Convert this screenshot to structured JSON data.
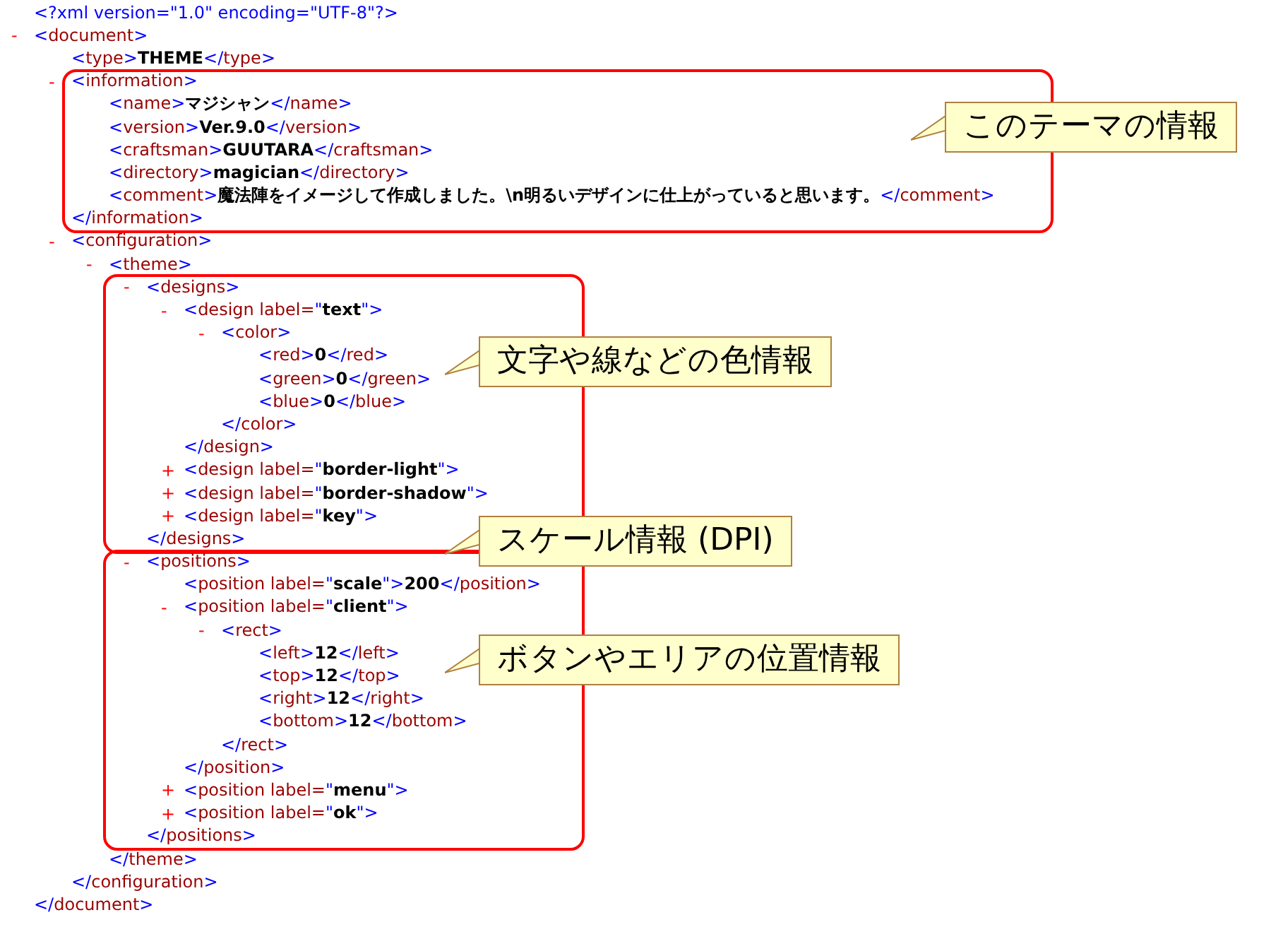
{
  "declaration": "<?xml version=\"1.0\" encoding=\"UTF-8\"?>",
  "tree": {
    "toggle": "-",
    "line": "<document>",
    "close": "</document>",
    "children": [
      {
        "line": "<type>THEME</type>"
      },
      {
        "toggle": "-",
        "line": "<information>",
        "close": "</information>",
        "highlight": true,
        "children": [
          {
            "line": "<name>マジシャン</name>"
          },
          {
            "line": "<version>Ver.9.0</version>"
          },
          {
            "line": "<craftsman>GUUTARA</craftsman>"
          },
          {
            "line": "<directory>magician</directory>"
          },
          {
            "line": "<comment>魔法陣をイメージして作成しました。\\n明るいデザインに仕上がっていると思います。</comment>"
          }
        ]
      },
      {
        "toggle": "-",
        "line": "<configuration>",
        "close": "</configuration>",
        "children": [
          {
            "toggle": "-",
            "line": "<theme>",
            "close": "</theme>",
            "children": [
              {
                "toggle": "-",
                "line": "<designs>",
                "close": "</designs>",
                "highlight": true,
                "children": [
                  {
                    "toggle": "-",
                    "line": "<design label=\"text\">",
                    "close": "</design>",
                    "children": [
                      {
                        "toggle": "-",
                        "line": "<color>",
                        "close": "</color>",
                        "children": [
                          {
                            "line": "<red>0</red>"
                          },
                          {
                            "line": "<green>0</green>"
                          },
                          {
                            "line": "<blue>0</blue>"
                          }
                        ]
                      }
                    ]
                  },
                  {
                    "toggle": "+",
                    "line": "<design label=\"border-light\">"
                  },
                  {
                    "toggle": "+",
                    "line": "<design label=\"border-shadow\">"
                  },
                  {
                    "toggle": "+",
                    "line": "<design label=\"key\">"
                  }
                ]
              },
              {
                "toggle": "-",
                "line": "<positions>",
                "close": "</positions>",
                "highlight": true,
                "children": [
                  {
                    "line": "<position label=\"scale\">200</position>"
                  },
                  {
                    "toggle": "-",
                    "line": "<position label=\"client\">",
                    "close": "</position>",
                    "children": [
                      {
                        "toggle": "-",
                        "line": "<rect>",
                        "close": "</rect>",
                        "children": [
                          {
                            "line": "<left>12</left>"
                          },
                          {
                            "line": "<top>12</top>"
                          },
                          {
                            "line": "<right>12</right>"
                          },
                          {
                            "line": "<bottom>12</bottom>"
                          }
                        ]
                      }
                    ]
                  },
                  {
                    "toggle": "+",
                    "line": "<position label=\"menu\">"
                  },
                  {
                    "toggle": "+",
                    "line": "<position label=\"ok\">"
                  }
                ]
              }
            ]
          }
        ]
      }
    ]
  },
  "callouts": [
    {
      "text": "このテーマの情報"
    },
    {
      "text": "文字や線などの色情報"
    },
    {
      "text": "スケール情報 (DPI)"
    },
    {
      "text": "ボタンやエリアの位置情報"
    }
  ]
}
